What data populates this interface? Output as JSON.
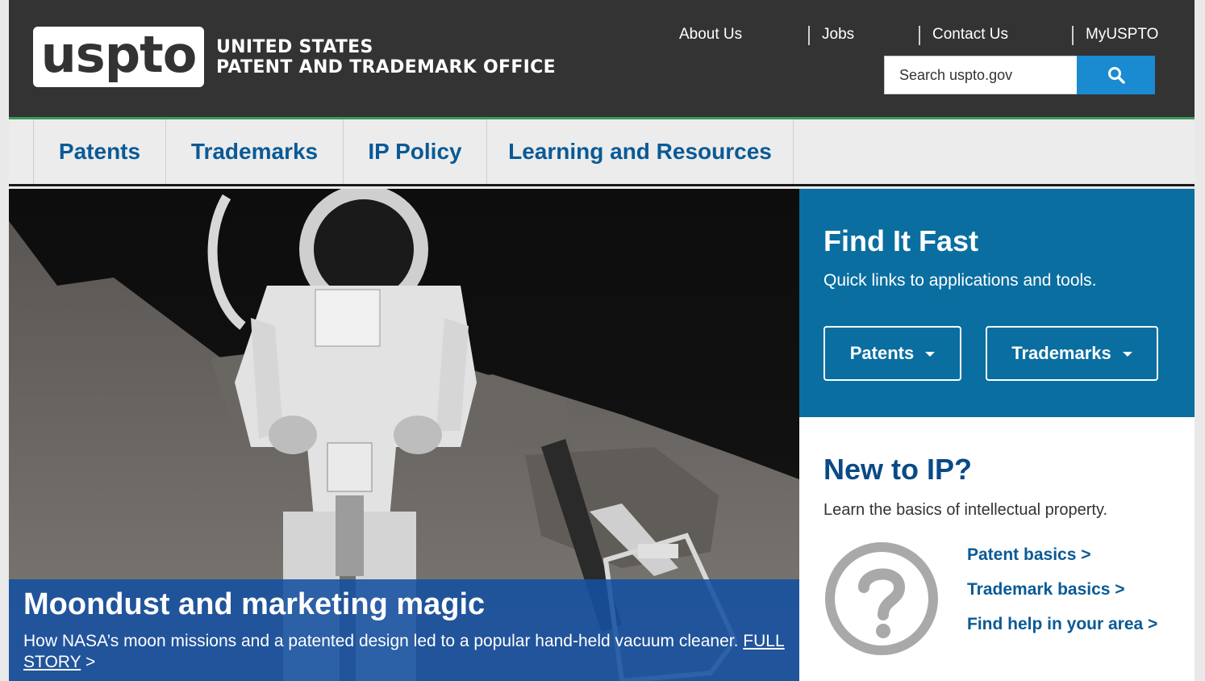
{
  "header": {
    "logo_word": "uspto",
    "logo_line1": "UNITED STATES",
    "logo_line2": "PATENT AND TRADEMARK OFFICE",
    "util_links": [
      "About Us",
      "Jobs",
      "Contact Us",
      "MyUSPTO"
    ],
    "search_placeholder": "Search uspto.gov",
    "search_icon": "search-icon"
  },
  "nav": {
    "items": [
      "Patents",
      "Trademarks",
      "IP Policy",
      "Learning and Resources"
    ]
  },
  "hero": {
    "title": "Moondust and marketing magic",
    "description": "How NASA’s moon missions and a patented design led to a popular hand-held vacuum cleaner.",
    "link_text": "FULL STORY",
    "link_suffix": ">"
  },
  "find_it_fast": {
    "title": "Find It Fast",
    "subtitle": "Quick links to applications and tools.",
    "buttons": [
      "Patents",
      "Trademarks"
    ]
  },
  "new_to_ip": {
    "title": "New to IP?",
    "subtitle": "Learn the basics of intellectual property.",
    "links": [
      "Patent basics >",
      "Trademark basics >",
      "Find help in your area >"
    ],
    "icon": "question-circle-icon"
  },
  "colors": {
    "header_bg": "#333333",
    "accent_green": "#3a9a5b",
    "nav_text": "#0a5a96",
    "search_button": "#1a8ad1",
    "find_it_fast_bg": "#0a6ea0",
    "caption_bg": "#1450a0"
  }
}
